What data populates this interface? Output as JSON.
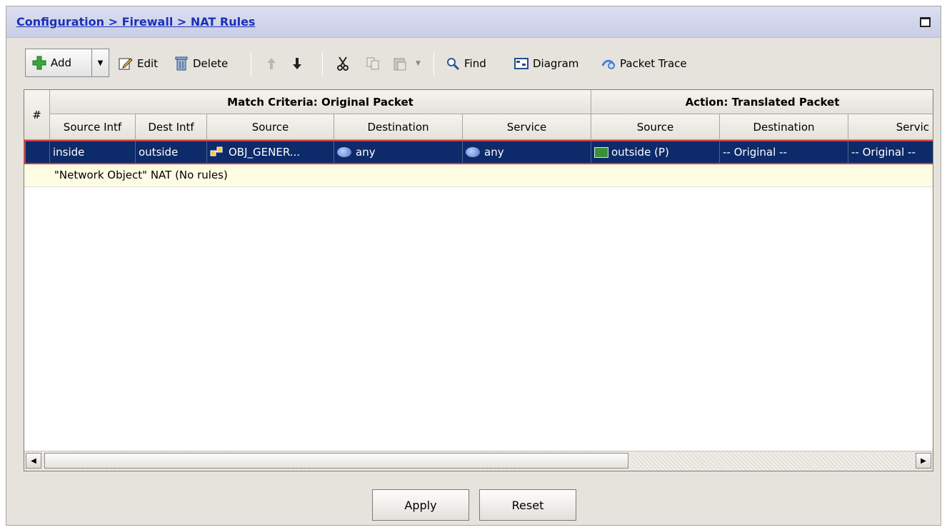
{
  "breadcrumb": {
    "items": [
      "Configuration",
      "Firewall",
      "NAT Rules"
    ],
    "separator": ">"
  },
  "toolbar": {
    "add_label": "Add",
    "edit_label": "Edit",
    "delete_label": "Delete",
    "find_label": "Find",
    "diagram_label": "Diagram",
    "packet_trace_label": "Packet Trace"
  },
  "table": {
    "num_header": "#",
    "group_match": "Match Criteria: Original Packet",
    "group_action": "Action: Translated Packet",
    "columns": [
      "Source Intf",
      "Dest Intf",
      "Source",
      "Destination",
      "Service",
      "Source",
      "Destination",
      "Servic"
    ],
    "rows": [
      {
        "source_intf": "inside",
        "dest_intf": "outside",
        "source": "OBJ_GENER...",
        "destination": "any",
        "service": "any",
        "t_source": "outside (P)",
        "t_destination": "-- Original --",
        "t_service": "-- Original --"
      }
    ],
    "network_object_row": "\"Network Object\" NAT (No rules)"
  },
  "buttons": {
    "apply": "Apply",
    "reset": "Reset"
  },
  "colors": {
    "selected_row_bg": "#0d2a6a",
    "selected_row_border": "#d23c3c",
    "breadcrumb_link": "#1a31b8"
  }
}
